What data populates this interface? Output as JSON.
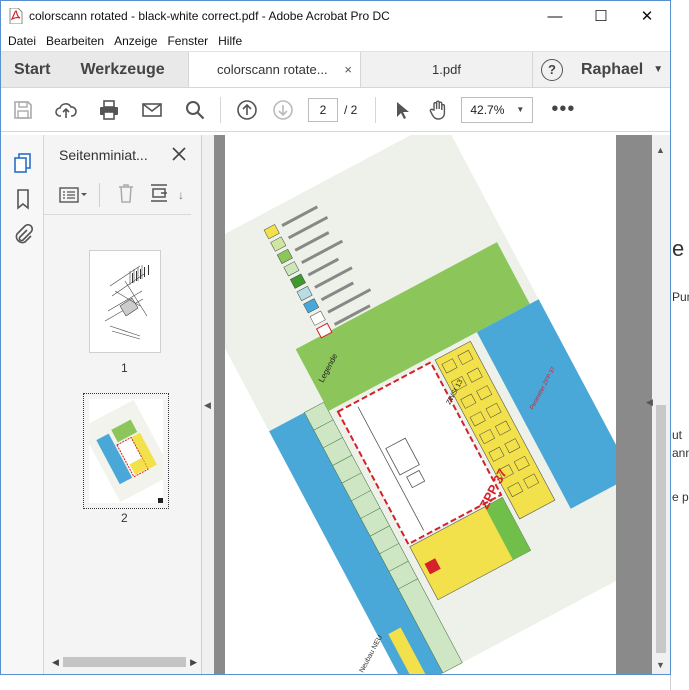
{
  "window": {
    "title": "colorscann rotated - black-white correct.pdf - Adobe Acrobat Pro DC",
    "minimize": "—",
    "maximize": "☐",
    "close": "✕"
  },
  "menu": [
    "Datei",
    "Bearbeiten",
    "Anzeige",
    "Fenster",
    "Hilfe"
  ],
  "tabs": {
    "home": "Start",
    "tools": "Werkzeuge",
    "doc1": "colorscann rotate...",
    "doc1_close": "×",
    "doc2": "1.pdf",
    "help": "?",
    "user": "Raphael"
  },
  "toolbar": {
    "page_current": "2",
    "page_total": "/ 2",
    "zoom": "42.7%",
    "more": "•••"
  },
  "panel": {
    "title": "Seitenminiat...",
    "thumbnails": [
      {
        "label": "1"
      },
      {
        "label": "2"
      }
    ]
  },
  "document": {
    "legend_title": "Legende",
    "zone_label": "ZPP 37",
    "item_label": "ZWSt 13",
    "perimeter_label": "Perimeter ZPP 37",
    "bottom_label": "Neubau NEU",
    "legend_entries": [
      "Wohnzone 2",
      "Wohnzone 3",
      "Mischzone",
      "Kernzone",
      "Gewerbezone",
      "Industriezone",
      "Zone f. öff. Nutz.",
      "Grünzone",
      "Freihaltezone",
      "Perimeter ZPP"
    ]
  },
  "background_window": {
    "fragments": [
      "e",
      "Pun",
      "ut",
      "ann",
      "e p"
    ]
  },
  "colors": {
    "yellow": "#f2e14a",
    "green": "#8cc65a",
    "blue": "#4aa8d8",
    "red": "#d6202a",
    "accent": "#5a8fd0"
  }
}
